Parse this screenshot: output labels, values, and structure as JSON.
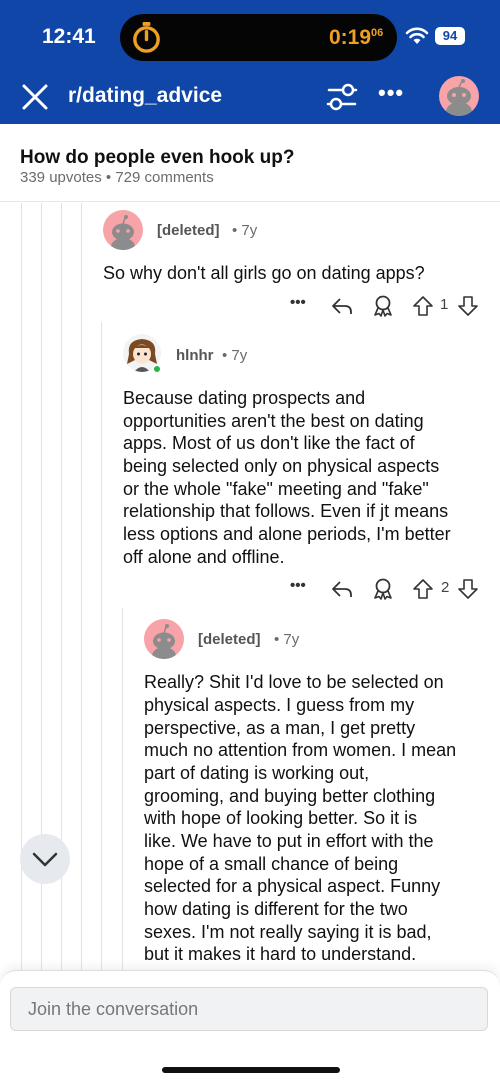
{
  "status_bar": {
    "time": "12:41",
    "timer_main": "0:19",
    "timer_fraction": "06",
    "battery": "94"
  },
  "header": {
    "subreddit": "r/dating_advice",
    "more_label": "•••"
  },
  "post": {
    "title": "How do people even hook up?",
    "meta": "339 upvotes • 729 comments"
  },
  "comments": [
    {
      "username": "[deleted]",
      "age": "• 7y",
      "body": "So why don't all girls go on dating apps?",
      "more_label": "•••",
      "votes": "1"
    },
    {
      "username": "hlnhr",
      "age": "• 7y",
      "lines": [
        "Because dating prospects and",
        "opportunities aren't the best on dating",
        "apps. Most of us don't like the fact of",
        "being selected only on physical aspects",
        "or the whole \"fake\" meeting and \"fake\"",
        "relationship that follows. Even if jt means",
        "less options and alone periods, I'm better",
        "off alone and offline."
      ],
      "more_label": "•••",
      "votes": "2"
    },
    {
      "username": "[deleted]",
      "age": "• 7y",
      "lines": [
        "Really? Shit I'd love to be selected on",
        "physical aspects. I guess from my",
        "perspective, as a man, I get pretty",
        "much no attention from women. I mean",
        "part of dating is working out,",
        "grooming, and buying better clothing",
        "with hope of looking better. So it is",
        "like. We have to put in effort with the",
        "hope of a small chance of being",
        "selected for a physical aspect. Funny",
        "how dating is different for the two",
        "sexes. I'm not really saying it is bad,",
        "but it makes it hard to understand."
      ]
    }
  ],
  "composer": {
    "placeholder": "Join the conversation"
  },
  "colors": {
    "header_blue": "#0f46a8",
    "timer_orange": "#f0a020",
    "avatar_pink": "#f7a3a8",
    "online_green": "#26b34a"
  },
  "icons": [
    "timer-icon",
    "wifi-icon",
    "close-icon",
    "filter-icon",
    "snoo-avatar-icon",
    "reply-icon",
    "award-icon",
    "upvote-icon",
    "downvote-icon",
    "chevron-down-icon"
  ]
}
